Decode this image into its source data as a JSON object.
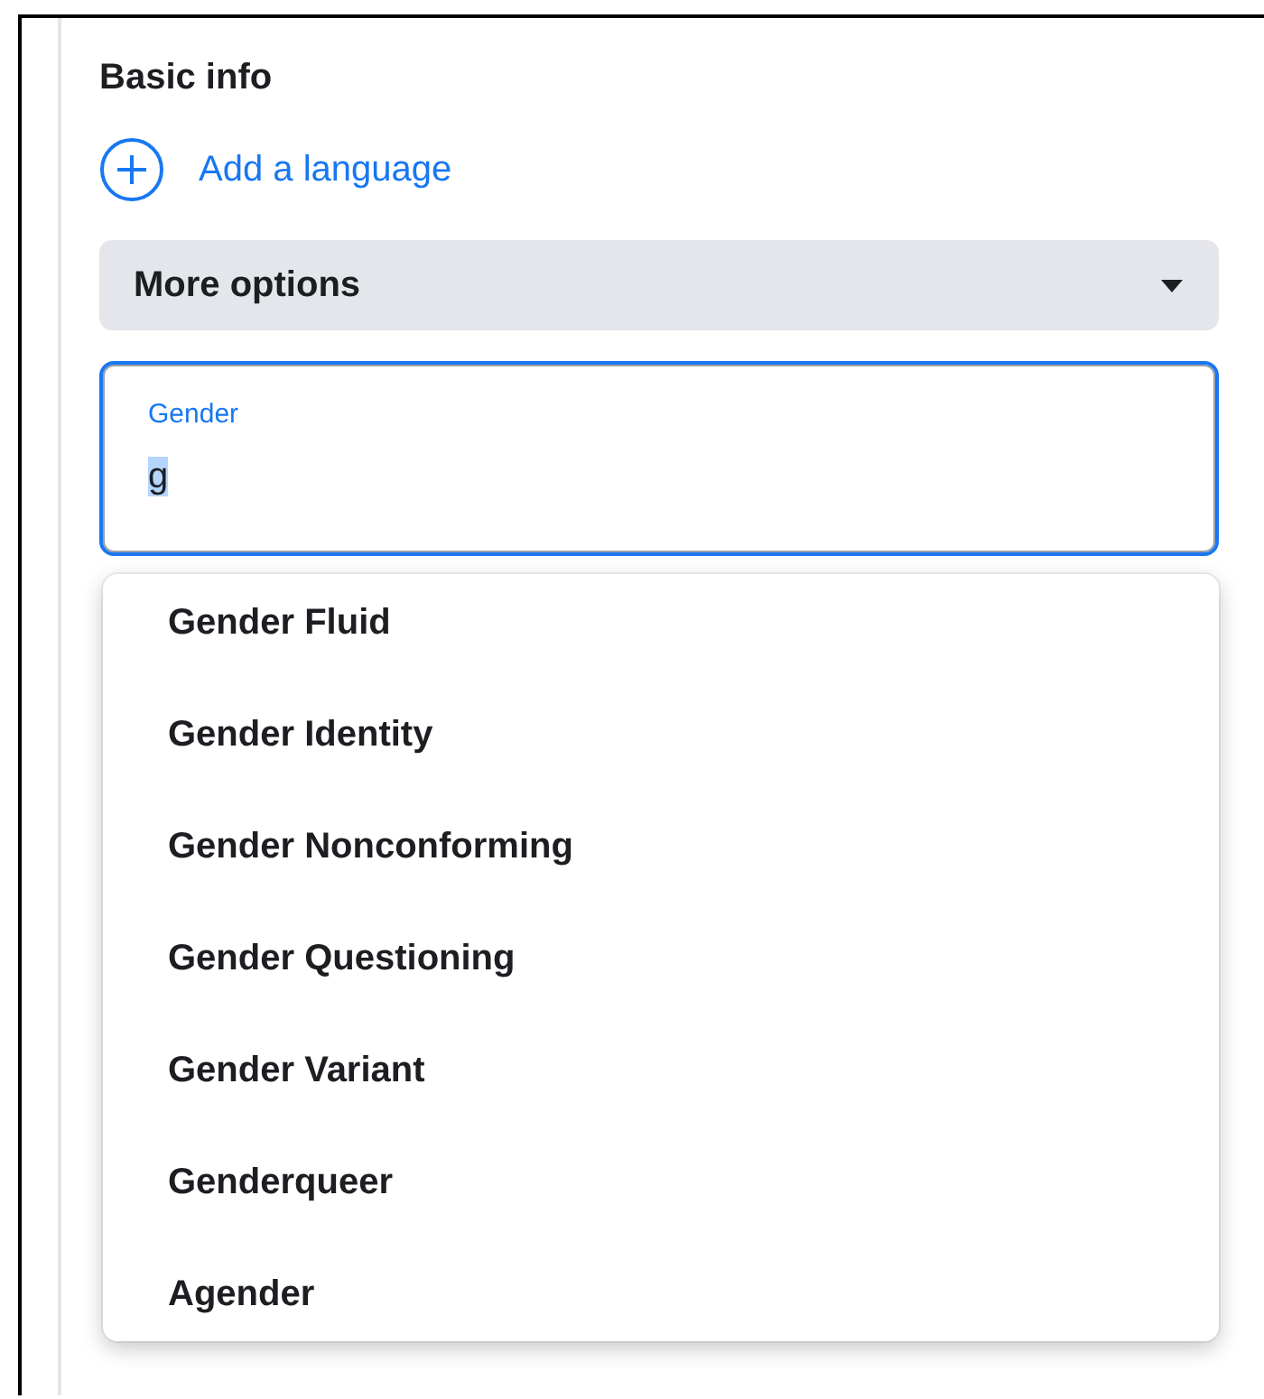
{
  "section": {
    "title": "Basic info"
  },
  "add_language": {
    "label": "Add a language"
  },
  "more_options": {
    "label": "More options",
    "expanded": false
  },
  "gender_field": {
    "label": "Gender",
    "value": "g",
    "focused": true
  },
  "suggestions": [
    {
      "label": "Gender Fluid"
    },
    {
      "label": "Gender Identity"
    },
    {
      "label": "Gender Nonconforming"
    },
    {
      "label": "Gender Questioning"
    },
    {
      "label": "Gender Variant"
    },
    {
      "label": "Genderqueer"
    },
    {
      "label": "Agender"
    }
  ]
}
